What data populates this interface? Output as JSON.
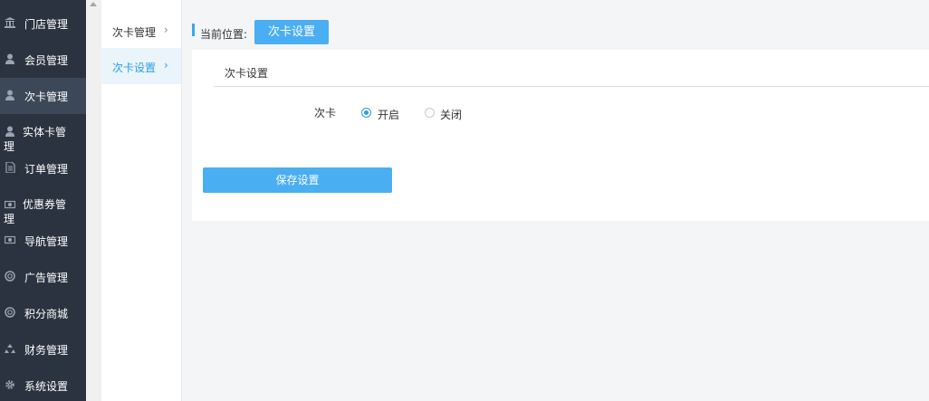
{
  "sidebar": {
    "items": [
      {
        "label": "门店管理",
        "icon": "bank-icon"
      },
      {
        "label": "会员管理",
        "icon": "user-icon"
      },
      {
        "label": "次卡管理",
        "icon": "user-icon",
        "active": true
      },
      {
        "label": "实体卡管理",
        "icon": "user-icon"
      },
      {
        "label": "订单管理",
        "icon": "document-icon"
      },
      {
        "label": "优惠券管理",
        "icon": "money-icon"
      },
      {
        "label": "导航管理",
        "icon": "money-icon"
      },
      {
        "label": "广告管理",
        "icon": "lifebuoy-icon"
      },
      {
        "label": "积分商城",
        "icon": "lifebuoy-icon"
      },
      {
        "label": "财务管理",
        "icon": "recycle-icon"
      },
      {
        "label": "系统设置",
        "icon": "gear-icon"
      }
    ]
  },
  "subnav": {
    "items": [
      {
        "label": "次卡管理",
        "active": false
      },
      {
        "label": "次卡设置",
        "active": true
      }
    ]
  },
  "breadcrumb": {
    "label": "当前位置:",
    "current": "次卡设置"
  },
  "panel": {
    "title": "次卡设置",
    "field_label": "次卡",
    "options": [
      {
        "label": "开启",
        "checked": true
      },
      {
        "label": "关闭",
        "checked": false
      }
    ],
    "save_label": "保存设置"
  },
  "colors": {
    "sidebar_bg": "#2b3340",
    "accent": "#4aaef3"
  }
}
